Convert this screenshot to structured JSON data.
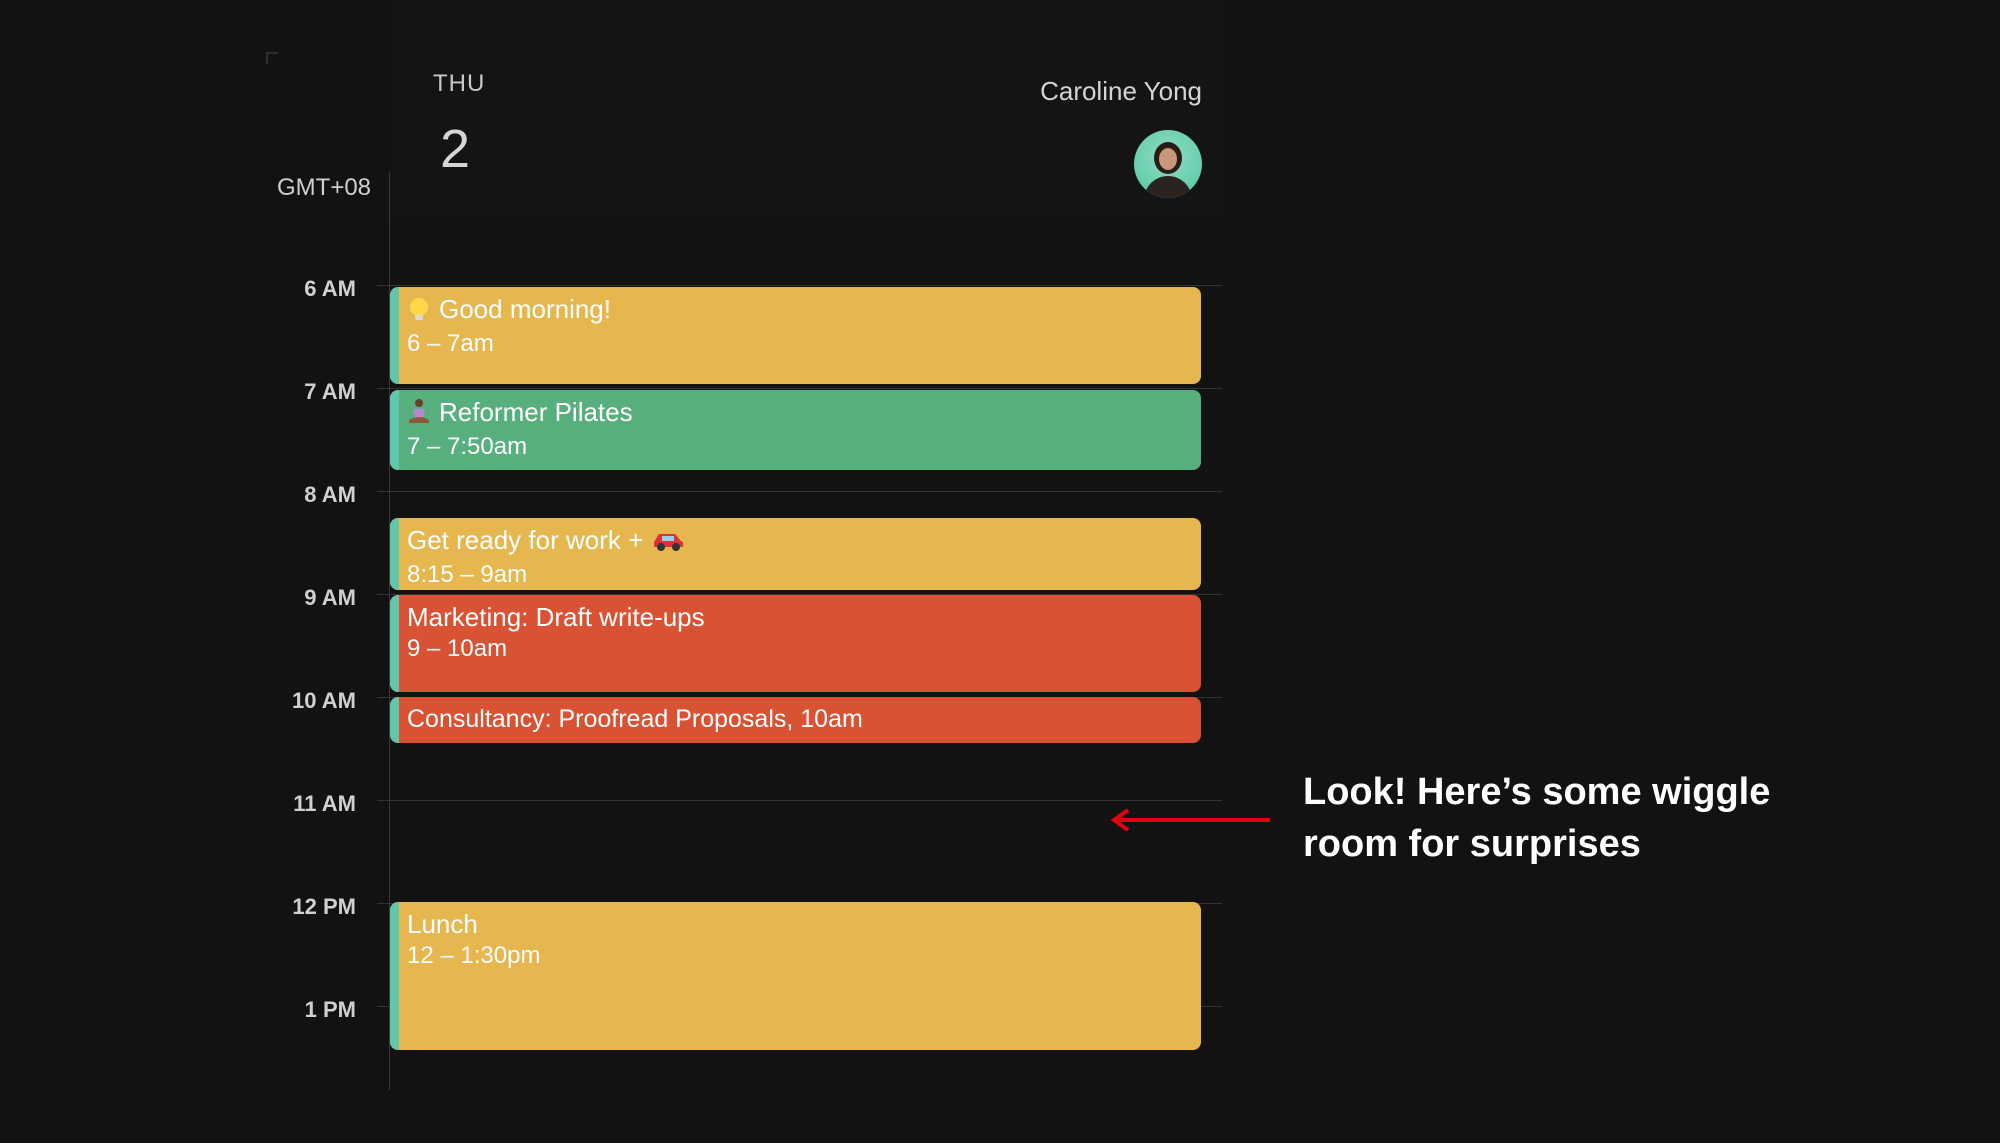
{
  "timezone": "GMT+08",
  "day": {
    "dow": "THU",
    "number": "2"
  },
  "user": {
    "name": "Caroline Yong"
  },
  "hours": [
    "6 AM",
    "7 AM",
    "8 AM",
    "9 AM",
    "10 AM",
    "11 AM",
    "12 PM",
    "1 PM"
  ],
  "events": [
    {
      "title": "Good morning!",
      "time": "6 – 7am",
      "icon": "sun-icon",
      "color": "#E5B74E"
    },
    {
      "title": "Reformer Pilates",
      "time": "7 – 7:50am",
      "icon": "person-in-lotus-icon",
      "color": "#57AF7E"
    },
    {
      "title": "Get ready for work +",
      "time": "8:15 – 9am",
      "icon": "car-icon",
      "color": "#E5B74E"
    },
    {
      "title": "Marketing: Draft write-ups",
      "time": "9 – 10am",
      "color": "#D95234"
    },
    {
      "title": "Consultancy: Proofread Proposals,",
      "time": "10am",
      "color": "#D95234"
    },
    {
      "title": "Lunch",
      "time": "12 – 1:30pm",
      "color": "#E5B74E"
    }
  ],
  "annotation": {
    "text": "Look! Here’s some wiggle room for surprises",
    "arrow_color": "#E3000F"
  }
}
